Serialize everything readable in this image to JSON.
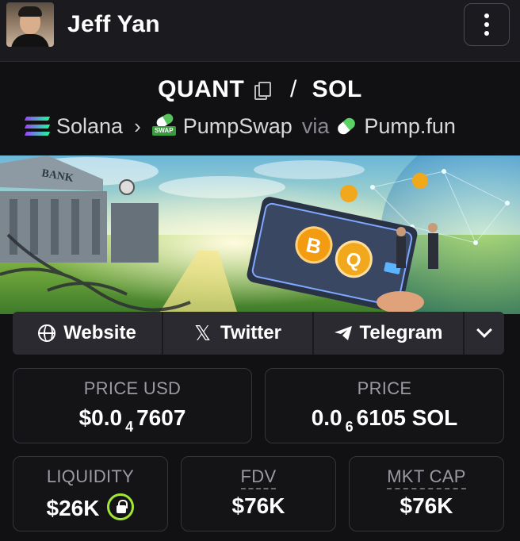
{
  "header": {
    "user_name": "Jeff Yan"
  },
  "token": {
    "base_symbol": "QUANT",
    "separator": "/",
    "quote_symbol": "SOL",
    "chain": "Solana",
    "dex": "PumpSwap",
    "via": "via",
    "launchpad": "Pump.fun",
    "dex_badge": "SWAP"
  },
  "banner": {
    "bank_sign": "BANK",
    "coin_1": "B",
    "coin_2": "Q"
  },
  "links": {
    "website": "Website",
    "twitter": "Twitter",
    "telegram": "Telegram",
    "x_glyph": "𝕏"
  },
  "stats": {
    "price_usd": {
      "label": "PRICE USD",
      "prefix": "$0.0",
      "zeros": "4",
      "digits": "7607"
    },
    "price_native": {
      "label": "PRICE",
      "prefix": "0.0",
      "zeros": "6",
      "digits": "6105 SOL"
    },
    "liquidity": {
      "label": "LIQUIDITY",
      "value": "$26K"
    },
    "fdv": {
      "label": "FDV",
      "value": "$76K"
    },
    "mkt_cap": {
      "label": "MKT CAP",
      "value": "$76K"
    }
  },
  "colors": {
    "background": "#111114",
    "card_border": "#34343b",
    "lock_ring": "#a3e635",
    "solana_gradient_start": "#9945ff",
    "solana_gradient_end": "#19fb9b"
  },
  "icons": [
    "avatar",
    "kebab-menu-icon",
    "copy-icon",
    "solana-icon",
    "pumpswap-icon",
    "pumpfun-icon",
    "globe-icon",
    "x-icon",
    "telegram-icon",
    "chevron-down-icon",
    "lock-icon"
  ]
}
